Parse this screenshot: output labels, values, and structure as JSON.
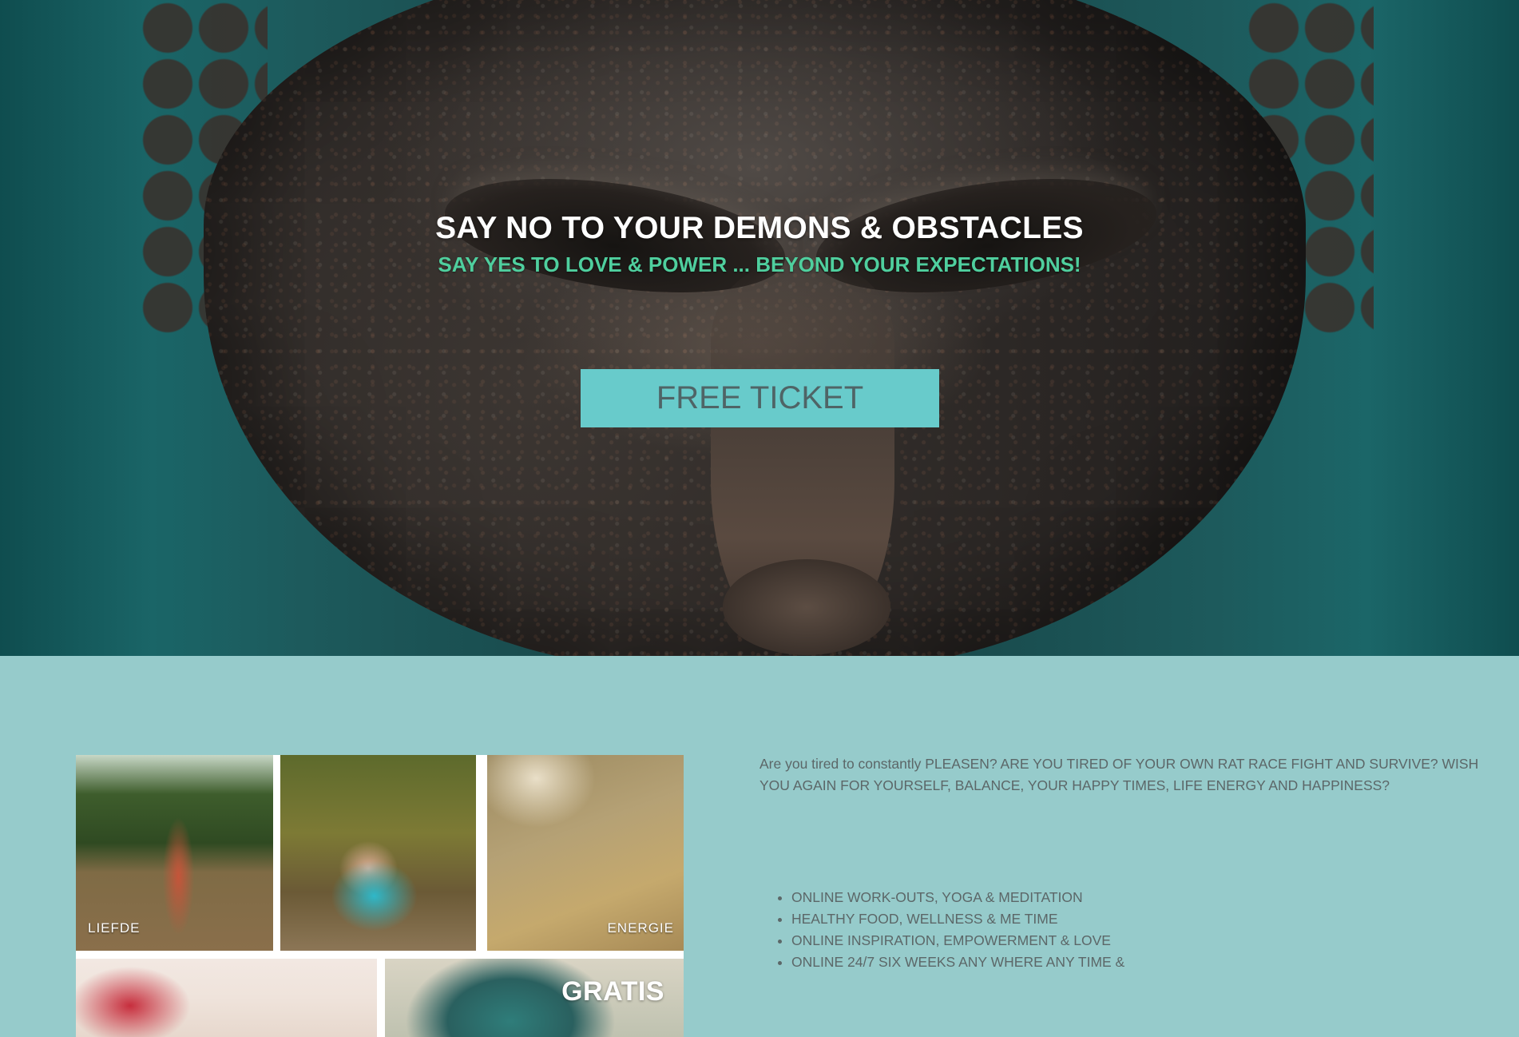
{
  "hero": {
    "title": "SAY NO TO YOUR DEMONS & OBSTACLES",
    "subtitle": "SAY YES TO LOVE & POWER ... BEYOND YOUR EXPECTATIONS!",
    "cta_label": "FREE TICKET",
    "image": "buddha-face-photo"
  },
  "collage": {
    "tiles": [
      {
        "label": "LIEFDE",
        "image": "woman-in-field-photo"
      },
      {
        "label": "",
        "image": "woman-on-swing-photo"
      },
      {
        "label": "ENERGIE",
        "image": "kicking-water-photo"
      },
      {
        "label": "",
        "image": "gift-hands-photo"
      },
      {
        "label": "GRATIS",
        "image": "buddha-statue-photo"
      }
    ]
  },
  "intro": {
    "text": "Are you tired to constantly PLEASEN? ARE YOU TIRED OF YOUR OWN RAT RACE FIGHT AND SURVIVE? WISH YOU AGAIN FOR YOURSELF, BALANCE, YOUR HAPPY TIMES, LIFE ENERGY AND HAPPINESS?"
  },
  "features": [
    "ONLINE WORK-OUTS, YOGA & MEDITATION",
    "HEALTHY FOOD, WELLNESS & ME TIME",
    "ONLINE INSPIRATION, EMPOWERMENT & LOVE",
    "ONLINE 24/7 SIX WEEKS ANY WHERE ANY TIME &"
  ],
  "colors": {
    "accent": "#68cbcb",
    "section_bg": "#96cbcb",
    "subtitle": "#4fcf9e"
  }
}
